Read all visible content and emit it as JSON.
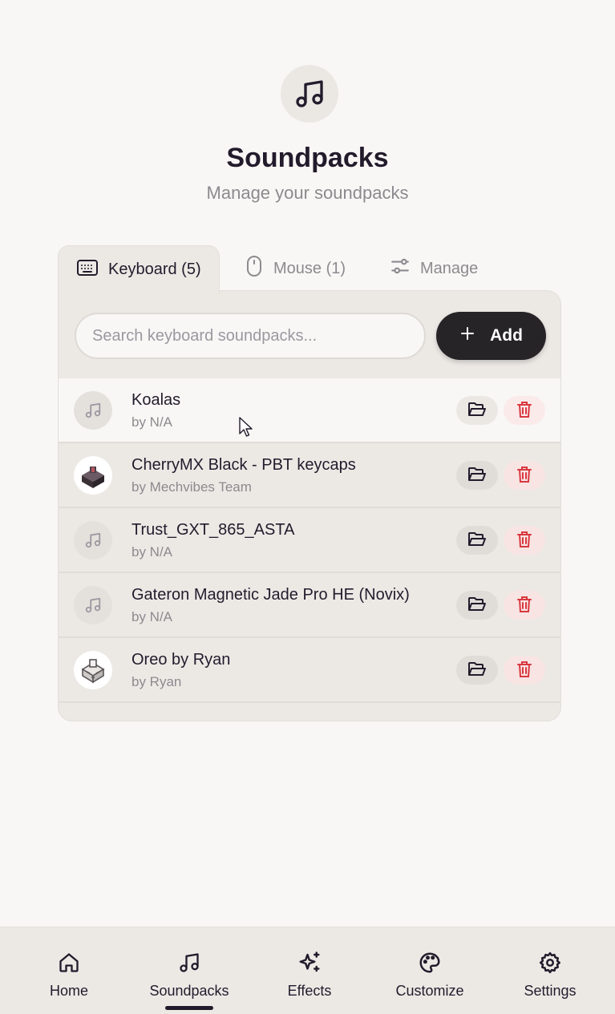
{
  "header": {
    "icon": "music-note-icon",
    "title": "Soundpacks",
    "subtitle": "Manage your soundpacks"
  },
  "tabs": [
    {
      "label": "Keyboard (5)",
      "icon": "keyboard-icon",
      "active": true
    },
    {
      "label": "Mouse (1)",
      "icon": "mouse-icon",
      "active": false
    },
    {
      "label": "Manage",
      "icon": "sliders-icon",
      "active": false
    }
  ],
  "search": {
    "placeholder": "Search keyboard soundpacks...",
    "value": ""
  },
  "add_button": {
    "label": "Add",
    "icon": "plus-icon"
  },
  "soundpacks": [
    {
      "name": "Koalas",
      "author": "by N/A",
      "avatar": "music-note-icon"
    },
    {
      "name": "CherryMX Black - PBT keycaps",
      "author": "by Mechvibes Team",
      "avatar": "switch-image"
    },
    {
      "name": "Trust_GXT_865_ASTA",
      "author": "by N/A",
      "avatar": "music-note-icon"
    },
    {
      "name": "Gateron Magnetic Jade Pro HE (Novix)",
      "author": "by N/A",
      "avatar": "music-note-icon"
    },
    {
      "name": "Oreo by Ryan",
      "author": "by Ryan",
      "avatar": "switch-image"
    }
  ],
  "row_actions": {
    "open_folder_icon": "folder-open-icon",
    "delete_icon": "trash-icon"
  },
  "bottom_nav": [
    {
      "label": "Home",
      "icon": "home-icon",
      "active": false
    },
    {
      "label": "Soundpacks",
      "icon": "music-note-icon",
      "active": true
    },
    {
      "label": "Effects",
      "icon": "sparkles-icon",
      "active": false
    },
    {
      "label": "Customize",
      "icon": "palette-icon",
      "active": false
    },
    {
      "label": "Settings",
      "icon": "gear-icon",
      "active": false
    }
  ],
  "colors": {
    "background": "#f8f7f5",
    "panel": "#ece9e5",
    "text": "#221b2c",
    "muted": "#8d8a8f",
    "add_button": "#262427",
    "delete": "#d9383f"
  }
}
